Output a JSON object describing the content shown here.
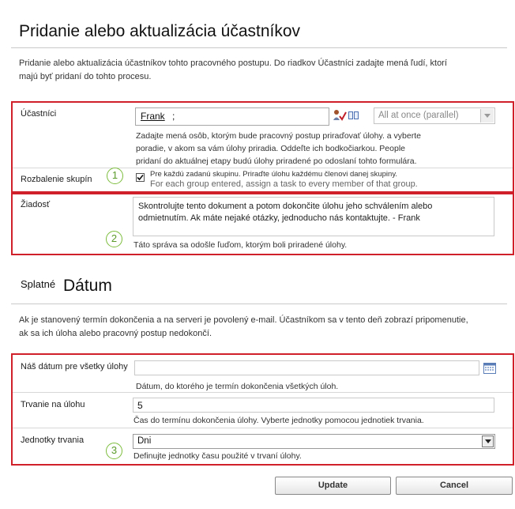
{
  "header": {
    "title": "Pridanie alebo aktualizácia účastníkov",
    "description_line1": "Pridanie alebo aktualizácia účastníkov tohto pracovného postupu. Do riadkov Účastníci zadajte mená ľudí, ktorí",
    "description_line2": "majú byť pridaní do tohto procesu."
  },
  "participants": {
    "label": "Účastníci",
    "value": "Frank",
    "value_suffix": ";",
    "order_select": "All at once (parallel)",
    "help_line1": "Zadajte mená osôb, ktorým bude pracovný postup priraďovať úlohy. a vyberte",
    "help_line2": "poradie, v akom sa vám úlohy priradia. Oddeľte ich bodkočiarkou. People",
    "help_line3": "pridaní do aktuálnej etapy budú úlohy priradené po odoslaní tohto formulára."
  },
  "expand_groups": {
    "label": "Rozbalenie skupín",
    "checked": true,
    "text_line1": "Pre každú zadanú skupinu. Priraďte úlohu každému členovi danej skupiny.",
    "text_line2": "For each group entered, assign a task to every member of that group."
  },
  "request": {
    "label": "Žiadosť",
    "text_line1": "Skontrolujte tento dokument a potom dokončite úlohu jeho schválením alebo",
    "text_line2": "odmietnutím. Ak máte nejaké otázky, jednoducho nás kontaktujte. - Frank",
    "help": "Táto správa sa odošle ľuďom, ktorým boli priradené úlohy."
  },
  "due": {
    "title_small": "Splatné",
    "title_big": "Dátum",
    "description_line1": "Ak je stanovený termín dokončenia a na serveri je povolený e-mail. Účastníkom sa v tento deň zobrazí pripomenutie,",
    "description_line2": "ak sa ich úloha alebo pracovný postup nedokončí."
  },
  "due_date": {
    "label": "Náš dátum pre všetky úlohy",
    "value": "",
    "help": "Dátum, do ktorého je termín dokončenia všetkých úloh."
  },
  "duration": {
    "label": "Trvanie na úlohu",
    "value": "5",
    "help": "Čas do termínu dokončenia úlohy. Vyberte jednotky pomocou jednotiek trvania."
  },
  "duration_units": {
    "label": "Jednotky trvania",
    "value": "Dni",
    "help": "Definujte jednotky času použité v trvaní úlohy."
  },
  "callouts": [
    "1",
    "2",
    "3"
  ],
  "buttons": {
    "update": "Update",
    "cancel": "Cancel"
  },
  "colors": {
    "section_border": "#d0202a",
    "callout": "#7cbd3c"
  }
}
